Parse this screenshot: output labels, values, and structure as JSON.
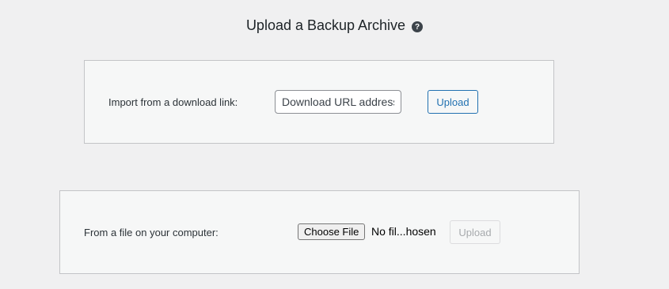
{
  "header": {
    "title": "Upload a Backup Archive",
    "help_icon": "question-circle-icon",
    "help_glyph": "?"
  },
  "url_import": {
    "label": "Import from a download link:",
    "placeholder": "Download URL address",
    "upload_label": "Upload"
  },
  "file_import": {
    "label": "From a file on your computer:",
    "choose_label": "Choose File",
    "file_status": "No fil...hosen",
    "upload_label": "Upload",
    "upload_disabled": true
  },
  "colors": {
    "background": "#f0f0f1",
    "panel": "#f6f7f7",
    "accent": "#2271b1"
  }
}
